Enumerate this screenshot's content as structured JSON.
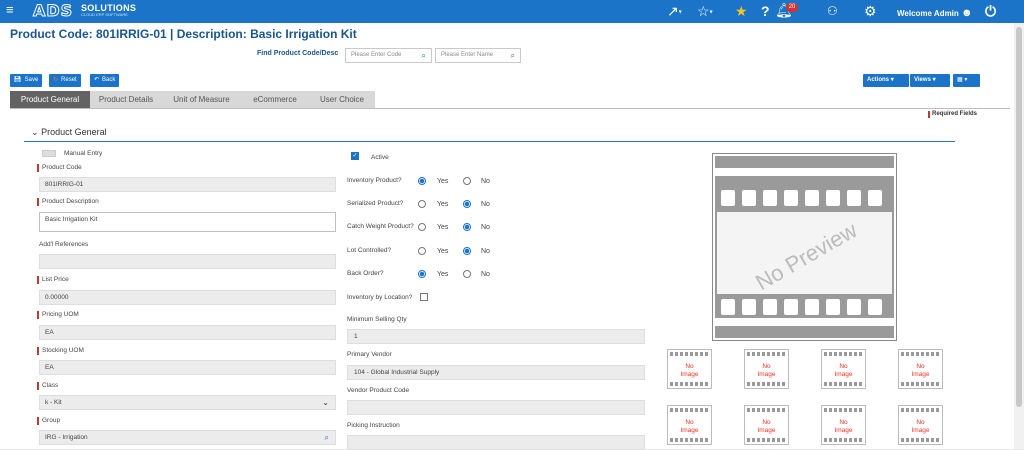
{
  "topbar": {
    "brand": "ADS",
    "brand_suffix": "SOLUTIONS",
    "tagline": "CLOUD ERP SOFTWARE",
    "notification_count": "20",
    "welcome": "Welcome Admin",
    "color": "#1b74c8"
  },
  "header": {
    "title": "Product Code:  801IRRIG-01 | Description: Basic Irrigation Kit",
    "find_label": "Find Product Code/Desc",
    "code_placeholder": "Please Enter Code",
    "name_placeholder": "Please Enter Name"
  },
  "toolbar": {
    "save": "Save",
    "reset": "Reset",
    "back": "Back",
    "actions": "Actions",
    "views": "Views"
  },
  "tabs": [
    "Product General",
    "Product Details",
    "Unit of Measure",
    "eCommerce",
    "User Choice"
  ],
  "required_fields": "Required Fields",
  "section": {
    "title": "Product General"
  },
  "left": {
    "manual_entry": "Manual Entry",
    "product_code_label": "Product Code",
    "product_code": "801IRRIG-01",
    "product_desc_label": "Product Description",
    "product_desc": "Basic Irrigation Kit",
    "addl_refs_label": "Add'l References",
    "addl_refs": "",
    "list_price_label": "List Price",
    "list_price": "0.00000",
    "pricing_uom_label": "Pricing UOM",
    "pricing_uom": "EA",
    "stocking_uom_label": "Stocking UOM",
    "stocking_uom": "EA",
    "class_label": "Class",
    "class": "k - Kit",
    "group_label": "Group",
    "group": "IRG - Irrigation"
  },
  "middle": {
    "active": "Active",
    "inventory_product": "Inventory Product?",
    "serialized_product": "Serialized Product?",
    "catch_weight_product": "Catch Weight Product?",
    "lot_controlled": "Lot Controlled?",
    "back_order": "Back Order?",
    "yes": "Yes",
    "no": "No",
    "inventory_by_location": "Inventory by Location?",
    "min_selling_qty_label": "Minimum Selling Qty",
    "min_selling_qty": "1",
    "primary_vendor_label": "Primary Vendor",
    "primary_vendor": "104 - Global Industrial Supply",
    "vendor_product_code_label": "Vendor Product Code",
    "vendor_product_code": "",
    "picking_instruction_label": "Picking Instruction"
  },
  "images": {
    "preview_text": "No Preview",
    "no_image_1": "No",
    "no_image_2": "Image"
  }
}
